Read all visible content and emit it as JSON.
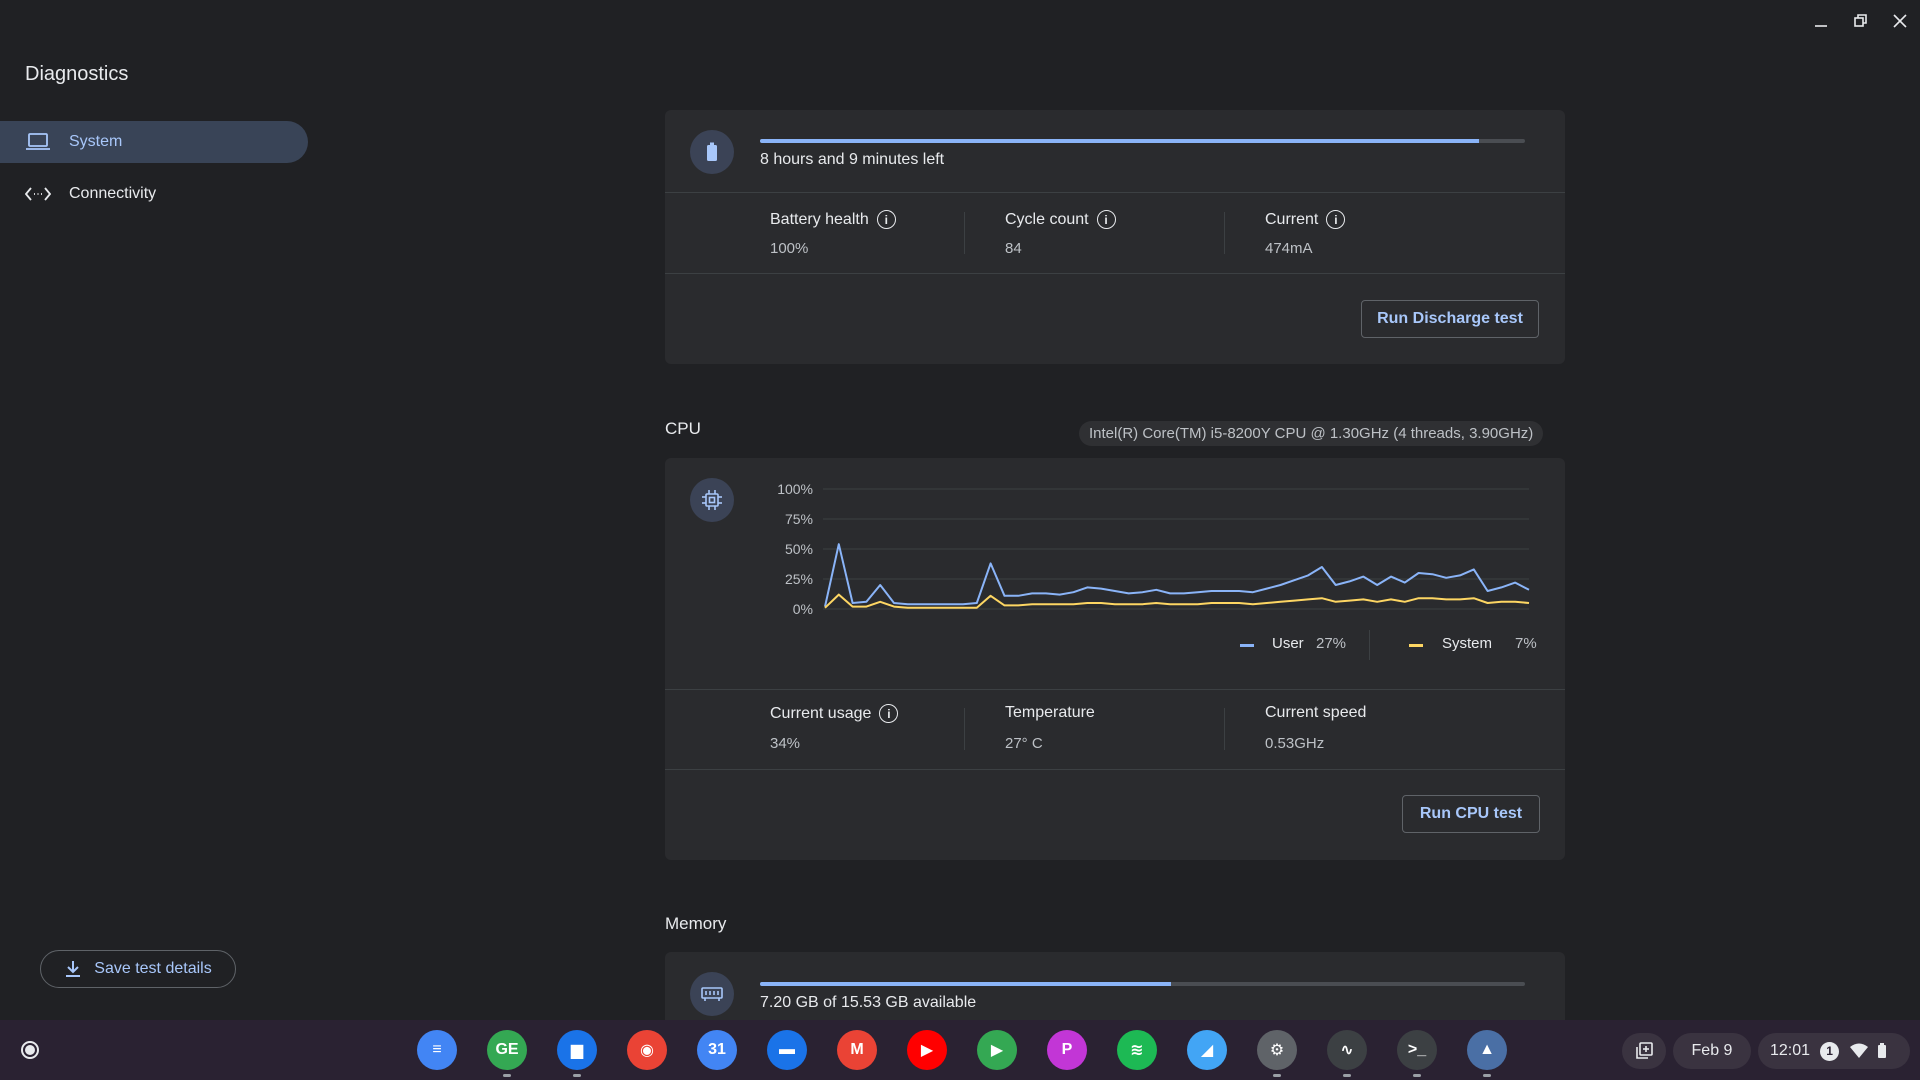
{
  "sidebar": {
    "title": "Diagnostics",
    "items": [
      {
        "label": "System",
        "icon": "laptop-icon",
        "active": true
      },
      {
        "label": "Connectivity",
        "icon": "connectivity-icon",
        "active": false
      }
    ],
    "save_label": "Save test details"
  },
  "battery": {
    "status": "8 hours and 9 minutes left",
    "charge_fraction": 0.94,
    "stats": [
      {
        "label": "Battery health",
        "value": "100%"
      },
      {
        "label": "Cycle count",
        "value": "84"
      },
      {
        "label": "Current",
        "value": "474mA"
      }
    ],
    "button_label": "Run Discharge test"
  },
  "cpu": {
    "title": "CPU",
    "model": "Intel(R) Core(TM) i5-8200Y CPU @ 1.30GHz (4 threads, 3.90GHz)",
    "legend": [
      {
        "name": "User",
        "value": "27%",
        "color": "#8ab4f8"
      },
      {
        "name": "System",
        "value": "7%",
        "color": "#fdd663"
      }
    ],
    "stats": [
      {
        "label": "Current usage",
        "value": "34%"
      },
      {
        "label": "Temperature",
        "value": "27° C"
      },
      {
        "label": "Current speed",
        "value": "0.53GHz"
      }
    ],
    "button_label": "Run CPU test"
  },
  "chart_data": {
    "type": "line",
    "y_ticks": [
      "100%",
      "75%",
      "50%",
      "25%",
      "0%"
    ],
    "ylim": [
      0,
      100
    ],
    "series": [
      {
        "name": "User",
        "color": "#8ab4f8",
        "values": [
          2,
          54,
          5,
          6,
          20,
          5,
          4,
          4,
          4,
          4,
          4,
          5,
          38,
          11,
          11,
          13,
          13,
          12,
          14,
          18,
          17,
          15,
          13,
          14,
          16,
          13,
          13,
          14,
          15,
          15,
          15,
          14,
          17,
          20,
          24,
          28,
          35,
          20,
          23,
          27,
          20,
          27,
          22,
          30,
          29,
          26,
          28,
          33,
          15,
          18,
          22,
          16
        ]
      },
      {
        "name": "System",
        "color": "#fdd663",
        "values": [
          1,
          12,
          2,
          2,
          6,
          2,
          1,
          1,
          1,
          1,
          1,
          1,
          11,
          3,
          3,
          4,
          4,
          4,
          4,
          5,
          5,
          4,
          4,
          4,
          5,
          4,
          4,
          4,
          5,
          5,
          5,
          4,
          5,
          6,
          7,
          8,
          9,
          6,
          7,
          8,
          6,
          8,
          6,
          9,
          9,
          8,
          8,
          9,
          5,
          6,
          6,
          5
        ]
      }
    ]
  },
  "memory": {
    "title": "Memory",
    "status": "7.20 GB of 15.53 GB available",
    "used_fraction": 0.537
  },
  "shelf": {
    "apps": [
      {
        "name": "docs",
        "label": "≡",
        "color": "#4285f4"
      },
      {
        "name": "gdrive-editor",
        "label": "GE",
        "color": "#34a853"
      },
      {
        "name": "files",
        "label": "▆",
        "color": "#1a73e8"
      },
      {
        "name": "chrome",
        "label": "◉",
        "color": "#ea4335"
      },
      {
        "name": "calendar",
        "label": "31",
        "color": "#4285f4"
      },
      {
        "name": "chat",
        "label": "▬",
        "color": "#1a73e8"
      },
      {
        "name": "gmail",
        "label": "M",
        "color": "#ea4335"
      },
      {
        "name": "youtube",
        "label": "▶",
        "color": "#ff0000"
      },
      {
        "name": "play-store",
        "label": "▶",
        "color": "#34a853"
      },
      {
        "name": "picsart",
        "label": "P",
        "color": "#c236d6"
      },
      {
        "name": "spotify",
        "label": "≋",
        "color": "#1db954"
      },
      {
        "name": "flutter",
        "label": "◢",
        "color": "#42a5f5"
      },
      {
        "name": "settings",
        "label": "⚙",
        "color": "#5f6368"
      },
      {
        "name": "diagnostics",
        "label": "∿",
        "color": "#3c4043"
      },
      {
        "name": "terminal",
        "label": ">_",
        "color": "#3c4043"
      },
      {
        "name": "gallery",
        "label": "▲",
        "color": "#4a6fa5"
      }
    ],
    "date": "Feb 9",
    "time": "12:01",
    "notification_count": "1"
  }
}
